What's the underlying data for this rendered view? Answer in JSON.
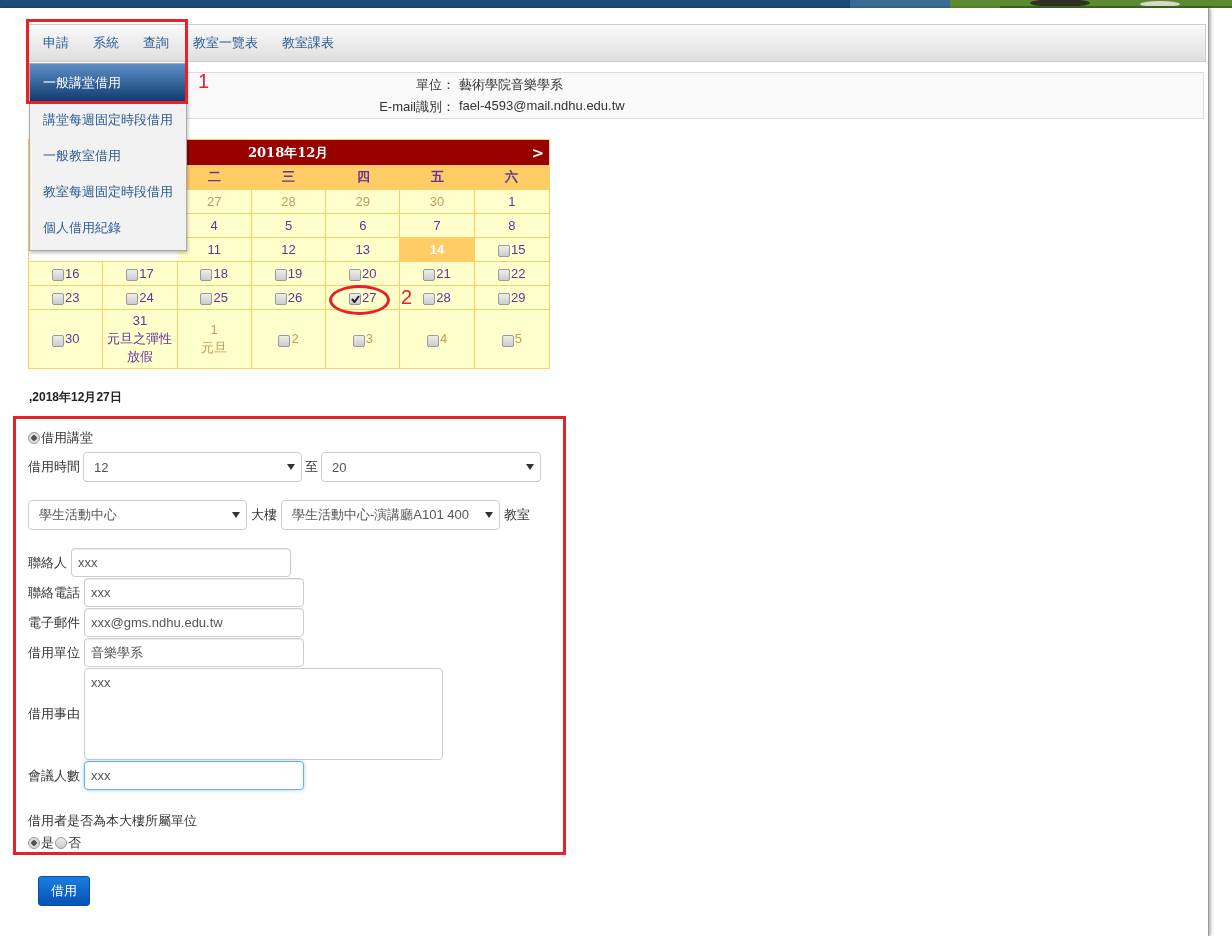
{
  "nav": {
    "items": [
      "申請",
      "系統",
      "查詢",
      "教室一覽表",
      "教室課表"
    ],
    "dropdown": [
      {
        "label": "一般講堂借用",
        "selected": true
      },
      {
        "label": "講堂每週固定時段借用",
        "selected": false
      },
      {
        "label": "一般教室借用",
        "selected": false
      },
      {
        "label": "教室每週固定時段借用",
        "selected": false
      },
      {
        "label": "個人借用紀錄",
        "selected": false
      }
    ]
  },
  "info": [
    {
      "label": "單位：",
      "value": "藝術學院音樂學系"
    },
    {
      "label": "E-mail識別：",
      "value": "fael-4593@mail.ndhu.edu.tw"
    }
  ],
  "calendar": {
    "title": "2018年12月",
    "next": ">",
    "weekdays": [
      "二",
      "三",
      "四",
      "五",
      "六"
    ],
    "weeks": [
      [
        {
          "day": "27",
          "other_month": true
        },
        {
          "day": "28",
          "other_month": true
        },
        {
          "day": "29",
          "other_month": true
        },
        {
          "day": "30",
          "other_month": true
        },
        {
          "day": "1"
        }
      ],
      [
        {
          "day": "4"
        },
        {
          "day": "5"
        },
        {
          "day": "6"
        },
        {
          "day": "7"
        },
        {
          "day": "8"
        }
      ],
      [
        {
          "day": "11"
        },
        {
          "day": "12"
        },
        {
          "day": "13"
        },
        {
          "day": "14",
          "today": true
        },
        {
          "day": "15",
          "checked": false
        }
      ],
      [
        {
          "day": "16",
          "checked": false
        },
        {
          "day": "17",
          "checked": false
        },
        {
          "day": "18",
          "checked": false
        },
        {
          "day": "19",
          "checked": false
        },
        {
          "day": "20",
          "checked": false
        },
        {
          "day": "21",
          "checked": false
        },
        {
          "day": "22",
          "checked": false
        }
      ],
      [
        {
          "day": "23",
          "checked": false
        },
        {
          "day": "24",
          "checked": false
        },
        {
          "day": "25",
          "checked": false
        },
        {
          "day": "26",
          "checked": false
        },
        {
          "day": "27",
          "checked": true
        },
        {
          "day": "28",
          "checked": false
        },
        {
          "day": "29",
          "checked": false
        }
      ],
      [
        {
          "day": "30",
          "checked": false
        },
        {
          "day": "31",
          "note": "元旦之彈性放假"
        },
        {
          "day": "1",
          "other_month": true,
          "note": "元旦"
        },
        {
          "day": "2",
          "other_month": true,
          "checked": false
        },
        {
          "day": "3",
          "other_month": true,
          "checked": false
        },
        {
          "day": "4",
          "other_month": true,
          "checked": false
        },
        {
          "day": "5",
          "other_month": true,
          "checked": false
        }
      ]
    ]
  },
  "selected_date": ",2018年12月27日",
  "form": {
    "venue_option": {
      "label": "借用講堂",
      "selected": true
    },
    "time": {
      "label": "借用時間",
      "from": "12",
      "separator": "至",
      "to": "20"
    },
    "building": {
      "value": "學生活動中心",
      "label": "大樓",
      "room": "學生活動中心-演講廳A101 400",
      "room_label": "教室"
    },
    "fields": [
      {
        "kind": "input",
        "label": "聯絡人",
        "value": "xxx",
        "focused": false
      },
      {
        "kind": "input",
        "label": "聯絡電話",
        "value": "xxx",
        "focused": false
      },
      {
        "kind": "input",
        "label": "電子郵件",
        "value": "xxx@gms.ndhu.edu.tw",
        "focused": false
      },
      {
        "kind": "input",
        "label": "借用單位",
        "value": "音樂學系",
        "focused": false
      },
      {
        "kind": "textarea",
        "label": "借用事由",
        "value": "xxx",
        "focused": false
      },
      {
        "kind": "input",
        "label": "會議人數",
        "value": "xxx",
        "focused": true
      }
    ],
    "question": "借用者是否為本大樓所屬單位",
    "choices": [
      {
        "label": "是",
        "selected": true
      },
      {
        "label": "否",
        "selected": false
      }
    ]
  },
  "submit": "借用",
  "annotations": [
    "1",
    "2"
  ]
}
